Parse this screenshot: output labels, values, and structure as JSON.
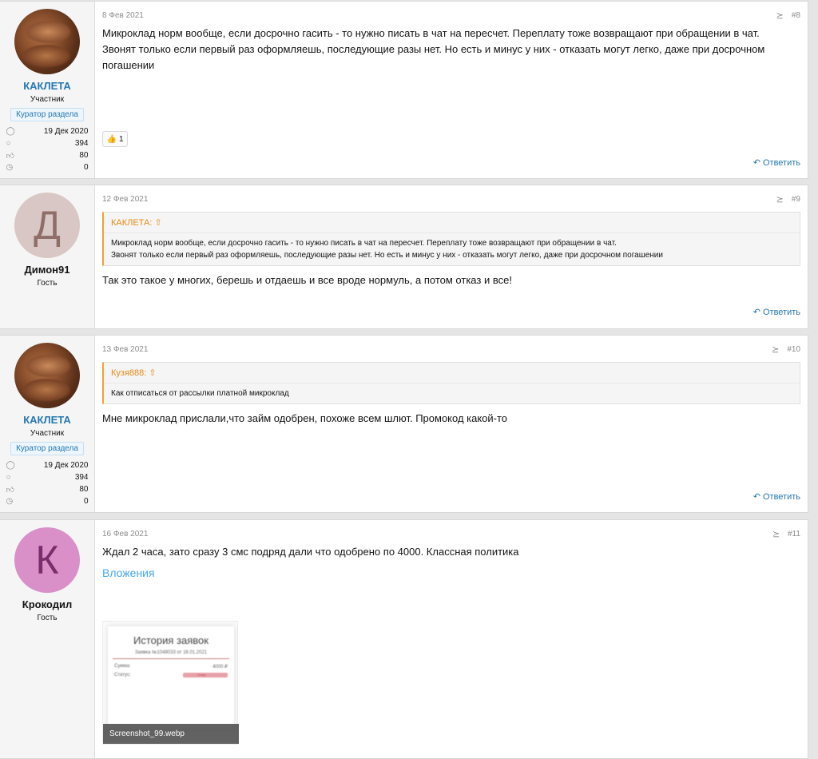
{
  "posts": [
    {
      "user": {
        "name": "КАКЛЕТА",
        "title": "Участник",
        "badge": "Куратор раздела",
        "joined": "19 Дек 2020",
        "messages": "394",
        "reactions": "80",
        "points": "0"
      },
      "date": "8 Фев 2021",
      "num": "#8",
      "lines": [
        "Микроклад норм вообще, если досрочно гасить - то нужно писать в чат на пересчет. Переплату тоже возвращают при обращении в чат.",
        "Звонят только если первый раз оформляешь, последующие разы нет. Но есть и минус у них - отказать могут легко, даже при досрочном погашении"
      ],
      "reaction_icon": "thumbs-up-icon",
      "reaction_count": "1",
      "reply": "Ответить"
    },
    {
      "user": {
        "name": "Димон91",
        "title": "Гость",
        "letter": "Д",
        "avatar_bg": "#d9c7c5",
        "avatar_fg": "#8f6d68"
      },
      "date": "12 Фев 2021",
      "num": "#9",
      "quote": {
        "author": "КАКЛЕТА:",
        "lines": [
          "Микроклад норм вообще, если досрочно гасить - то нужно писать в чат на пересчет. Переплату тоже возвращают при обращении в чат.",
          "Звонят только если первый раз оформляешь, последующие разы нет. Но есть и минус у них - отказать могут легко, даже при досрочном погашении"
        ]
      },
      "text": "Так это такое у многих, берешь и отдаешь и все вроде нормуль, а потом отказ и все!",
      "reply": "Ответить"
    },
    {
      "user": {
        "name": "КАКЛЕТА",
        "title": "Участник",
        "badge": "Куратор раздела",
        "joined": "19 Дек 2020",
        "messages": "394",
        "reactions": "80",
        "points": "0"
      },
      "date": "13 Фев 2021",
      "num": "#10",
      "quote": {
        "author": "Кузя888:",
        "lines": [
          "Как отписаться от рассылки платной микроклад"
        ]
      },
      "text": "Мне микроклад прислали,что займ одобрен, похоже всем шлют. Промокод какой-то",
      "reply": "Ответить"
    },
    {
      "user": {
        "name": "Крокодил",
        "title": "Гость",
        "letter": "К",
        "avatar_bg": "#d98fc8",
        "avatar_fg": "#7a2d6b"
      },
      "date": "16 Фев 2021",
      "num": "#11",
      "text": "Ждал 2 часа, зато сразу 3 смс подряд дали что одобрено по 4000. Классная политика",
      "attachments_title": "Вложения",
      "attachment": {
        "filename": "Screenshot_99.webp",
        "preview_title": "История заявок",
        "preview_subtitle": "Заявка №1048033 от 16.01.2021",
        "preview_sum_label": "Сумма:",
        "preview_sum_value": "4000 ₽",
        "preview_status_label": "Статус:",
        "preview_status_value": "Отказ"
      }
    }
  ],
  "icons": {
    "share": "share-icon",
    "user": "user-icon",
    "messages": "speech-bubble-icon",
    "reactions": "thumbs-up-icon",
    "points": "clock-icon",
    "reply": "reply-arrow-icon",
    "quote_up": "arrow-up-circle-icon"
  },
  "colors": {
    "member_name": "#2577b1",
    "quote_accent": "#f7a02d",
    "link": "#2577b1",
    "attach_title": "#47a7eb"
  }
}
